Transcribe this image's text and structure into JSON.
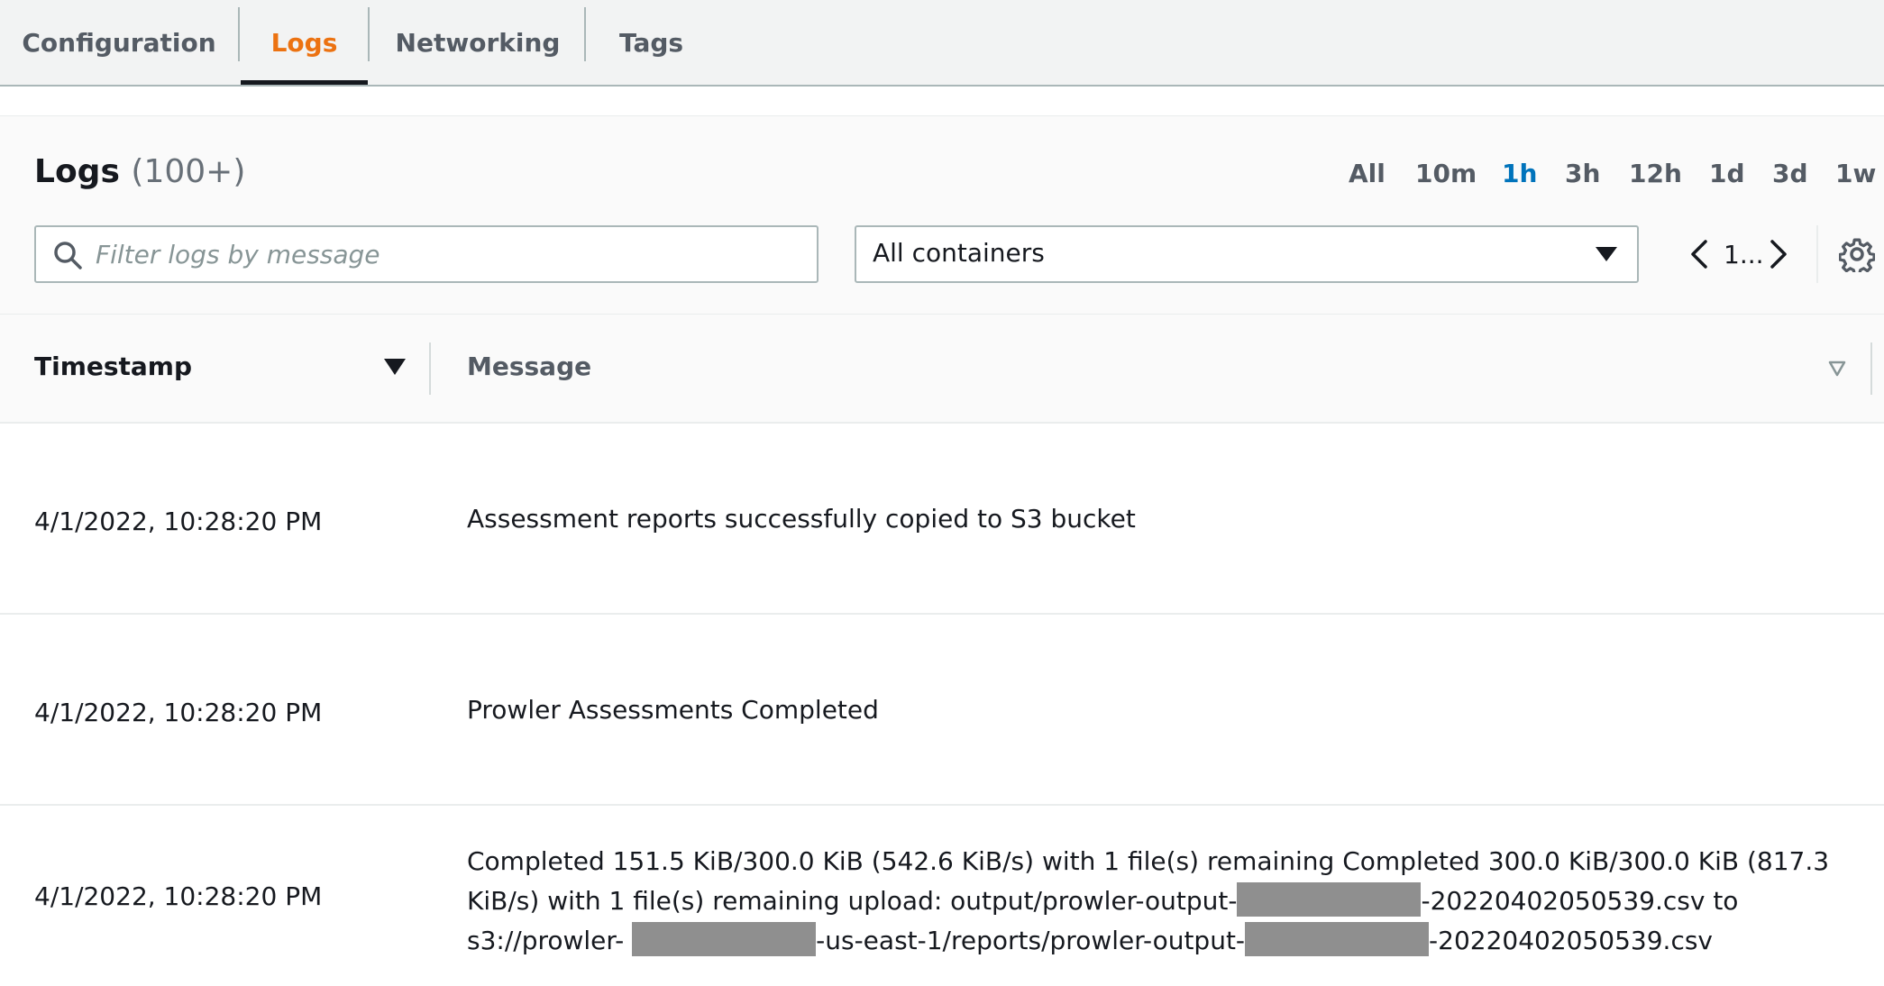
{
  "tabs": [
    {
      "label": "Configuration",
      "active": false
    },
    {
      "label": "Logs",
      "active": true
    },
    {
      "label": "Networking",
      "active": false
    },
    {
      "label": "Tags",
      "active": false
    }
  ],
  "logs_panel": {
    "title": "Logs",
    "count": "(100+)",
    "time_ranges": [
      "All",
      "10m",
      "1h",
      "3h",
      "12h",
      "1d",
      "3d",
      "1w"
    ],
    "active_time_range": "1h",
    "search_placeholder": "Filter logs by message",
    "search_value": "",
    "container_filter": "All containers",
    "pagination_label": "1..."
  },
  "table": {
    "columns": [
      "Timestamp",
      "Message"
    ],
    "sorted_column": "Timestamp",
    "sort_direction": "descending",
    "rows": [
      {
        "timestamp": "4/1/2022, 10:28:20 PM",
        "message": "Assessment reports successfully copied to S3 bucket"
      },
      {
        "timestamp": "4/1/2022, 10:28:20 PM",
        "message": "Prowler Assessments Completed"
      },
      {
        "timestamp": "4/1/2022, 10:28:20 PM",
        "message_parts": [
          "Completed 151.5 KiB/300.0 KiB (542.6 KiB/s) with 1 file(s) remaining Completed 300.0 KiB/300.0 KiB (817.3 KiB/s) with 1 file(s) remaining upload: output/prowler-output-",
          "-20220402050539.csv to s3://prowler-",
          "-us-east-1/reports/prowler-output-",
          "-20220402050539.csv"
        ]
      }
    ]
  },
  "icons": {
    "search": "search-icon",
    "dropdown": "caret-down-icon",
    "prev": "chevron-left-icon",
    "next": "chevron-right-icon",
    "settings": "gear-icon",
    "sort_desc": "sort-descending-icon",
    "sort_none": "sort-unsorted-icon"
  },
  "colors": {
    "active_tab": "#ec7211",
    "active_range": "#0073bb",
    "text": "#16191f",
    "muted": "#545b64",
    "redaction": "#8f8f8f"
  }
}
